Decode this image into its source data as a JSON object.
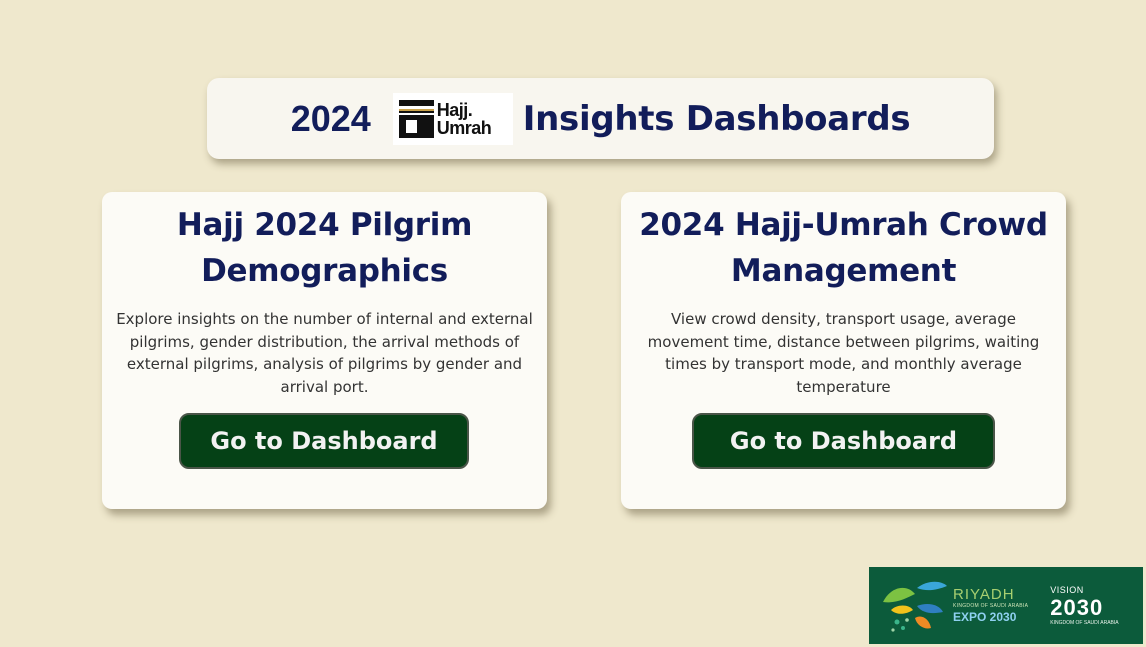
{
  "header": {
    "year": "2024",
    "logo_line1": "Hajj.",
    "logo_line2": "Umrah",
    "title": "Insights Dashboards"
  },
  "cards": [
    {
      "title": "Hajj 2024 Pilgrim Demographics",
      "description": "Explore insights on the number of internal and external pilgrims, gender distribution, the arrival methods of external pilgrims, analysis of pilgrims by gender and arrival port.",
      "button_label": "Go to Dashboard"
    },
    {
      "title": "2024 Hajj-Umrah Crowd Management",
      "description": "View crowd density, transport usage, average movement time, distance between pilgrims, waiting times by transport mode, and monthly average temperature",
      "button_label": "Go to Dashboard"
    }
  ],
  "footer": {
    "expo_city": "RIYADH",
    "expo_sub": "KINGDOM OF SAUDI ARABIA",
    "expo_name": "EXPO 2030",
    "vision_label": "VISION",
    "vision_year": "2030",
    "vision_sub": "KINGDOM OF SAUDI ARABIA"
  },
  "colors": {
    "background": "#efe8cd",
    "title_navy": "#121d5a",
    "button_green": "#054116",
    "footer_green": "#0c5b3b"
  },
  "icons": {
    "hajj_logo": "kaaba-icon",
    "expo_logo": "expo-emblem-icon"
  }
}
